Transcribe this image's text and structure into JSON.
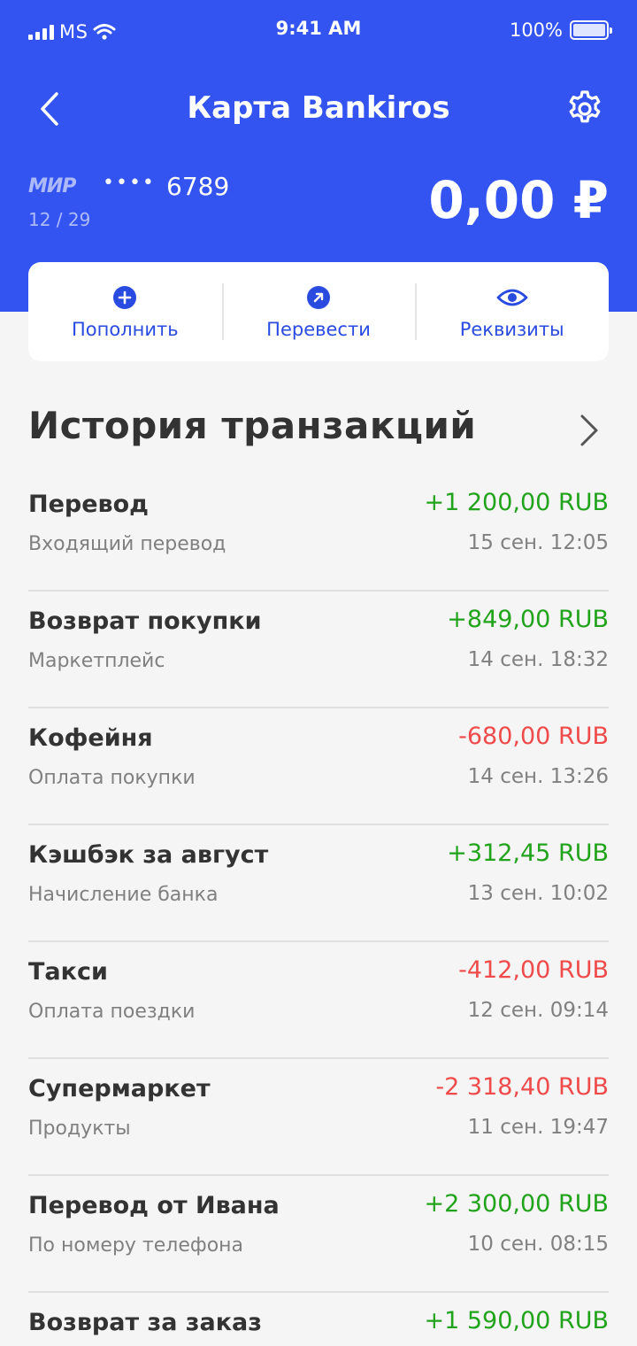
{
  "status_bar": {
    "carrier": "MS",
    "time": "9:41 AM",
    "battery": "100%"
  },
  "header": {
    "title": "Карта Bankiros",
    "back_icon": "chevron-left-icon",
    "settings_icon": "gear-icon"
  },
  "card": {
    "brand": "МИР",
    "masked": "••••",
    "last4": "6789",
    "expiry": "12 / 29",
    "balance": "0,00 ₽"
  },
  "actions": [
    {
      "label": "Пополнить",
      "icon": "plus-circle-icon"
    },
    {
      "label": "Перевести",
      "icon": "arrow-up-right-circle-icon"
    },
    {
      "label": "Реквизиты",
      "icon": "eye-icon"
    }
  ],
  "history": {
    "title": "История транзакций",
    "items": [
      {
        "title": "Перевод",
        "subtitle": "Входящий перевод",
        "amount": "+1 200,00 RUB",
        "date": "15 сен. 12:05",
        "sign": "pos"
      },
      {
        "title": "Возврат покупки",
        "subtitle": "Маркетплейс",
        "amount": "+849,00 RUB",
        "date": "14 сен. 18:32",
        "sign": "pos"
      },
      {
        "title": "Кофейня",
        "subtitle": "Оплата покупки",
        "amount": "-680,00 RUB",
        "date": "14 сен. 13:26",
        "sign": "neg"
      },
      {
        "title": "Кэшбэк за август",
        "subtitle": "Начисление банка",
        "amount": "+312,45 RUB",
        "date": "13 сен. 10:02",
        "sign": "pos"
      },
      {
        "title": "Такси",
        "subtitle": "Оплата поездки",
        "amount": "-412,00 RUB",
        "date": "12 сен. 09:14",
        "sign": "neg"
      },
      {
        "title": "Супермаркет",
        "subtitle": "Продукты",
        "amount": "-2 318,40 RUB",
        "date": "11 сен. 19:47",
        "sign": "neg"
      },
      {
        "title": "Перевод от Ивана",
        "subtitle": "По номеру телефона",
        "amount": "+2 300,00 RUB",
        "date": "10 сен. 08:15",
        "sign": "pos"
      },
      {
        "title": "Возврат за заказ",
        "subtitle": "",
        "amount": "+1 590,00 RUB",
        "date": "",
        "sign": "pos"
      }
    ]
  },
  "colors": {
    "brand_blue": "#3354f0",
    "action_text": "#2a4be0",
    "positive": "#21a31c",
    "negative": "#f04b4b"
  }
}
